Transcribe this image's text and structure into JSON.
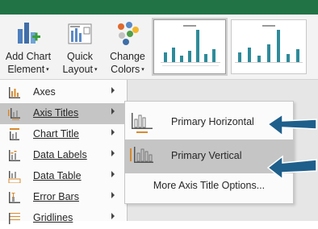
{
  "ribbon": {
    "add_chart_line1": "Add Chart",
    "add_chart_line2": "Element",
    "quick_line1": "Quick",
    "quick_line2": "Layout",
    "change_line1": "Change",
    "change_line2": "Colors",
    "dropdown_caret": "▾"
  },
  "menu": {
    "items": [
      {
        "label": "Axes",
        "icon": "axes-icon"
      },
      {
        "label": "Axis Titles",
        "icon": "axis-titles-icon"
      },
      {
        "label": "Chart Title",
        "icon": "chart-title-icon"
      },
      {
        "label": "Data Labels",
        "icon": "data-labels-icon"
      },
      {
        "label": "Data Table",
        "icon": "data-table-icon"
      },
      {
        "label": "Error Bars",
        "icon": "error-bars-icon"
      },
      {
        "label": "Gridlines",
        "icon": "gridlines-icon"
      }
    ]
  },
  "submenu": {
    "items": [
      {
        "label": "Primary Horizontal",
        "icon": "primary-horizontal-icon"
      },
      {
        "label": "Primary Vertical",
        "icon": "primary-vertical-icon"
      }
    ],
    "more": "More Axis Title Options..."
  },
  "colors": {
    "title_bar": "#217346",
    "highlight": "#c5c5c5",
    "annotation_arrow": "#1f5f8b",
    "bar_teal": "#2e8b9a"
  }
}
